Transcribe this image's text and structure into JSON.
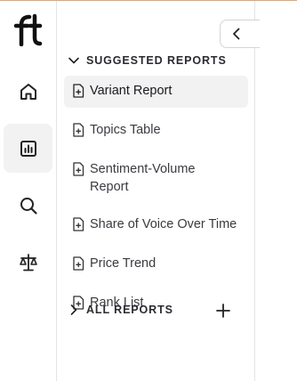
{
  "brand": {
    "logo_text": "ft"
  },
  "rail": {
    "items": [
      {
        "icon": "home-icon",
        "active": false
      },
      {
        "icon": "reports-icon",
        "active": true
      },
      {
        "icon": "search-icon",
        "active": false
      },
      {
        "icon": "scale-icon",
        "active": false
      }
    ]
  },
  "panel": {
    "suggested_label": "SUGGESTED REPORTS",
    "all_label": "ALL REPORTS",
    "reports": [
      {
        "label": "Variant Report",
        "selected": true
      },
      {
        "label": "Topics Table",
        "selected": false
      },
      {
        "label": "Sentiment-Volume Report",
        "selected": false
      },
      {
        "label": "Share of Voice Over Time",
        "selected": false
      },
      {
        "label": "Price Trend",
        "selected": false
      },
      {
        "label": "Rank List",
        "selected": false
      }
    ]
  },
  "colors": {
    "accent_line": "#f0a060",
    "selected_bg": "#f2f2f3",
    "border": "#e4e4e7"
  }
}
